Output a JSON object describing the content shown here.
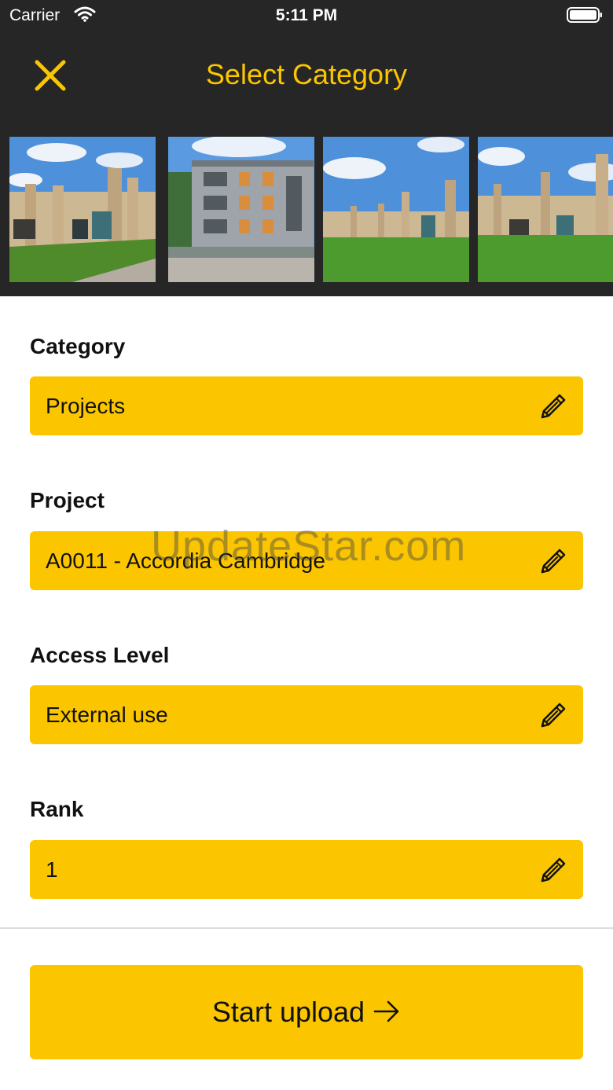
{
  "status_bar": {
    "carrier": "Carrier",
    "time": "5:11 PM"
  },
  "header": {
    "title": "Select Category"
  },
  "thumbnails": [
    {
      "name": "building-photo-1"
    },
    {
      "name": "building-photo-2"
    },
    {
      "name": "building-photo-3"
    },
    {
      "name": "building-photo-4"
    }
  ],
  "fields": {
    "category": {
      "label": "Category",
      "value": "Projects"
    },
    "project": {
      "label": "Project",
      "value": "A0011 - Accordia Cambridge"
    },
    "access_level": {
      "label": "Access Level",
      "value": "External use"
    },
    "rank": {
      "label": "Rank",
      "value": "1"
    }
  },
  "upload": {
    "label": "Start upload"
  },
  "watermark": "UpdateStar.com",
  "colors": {
    "accent": "#fbc600",
    "header_bg": "#262626"
  }
}
